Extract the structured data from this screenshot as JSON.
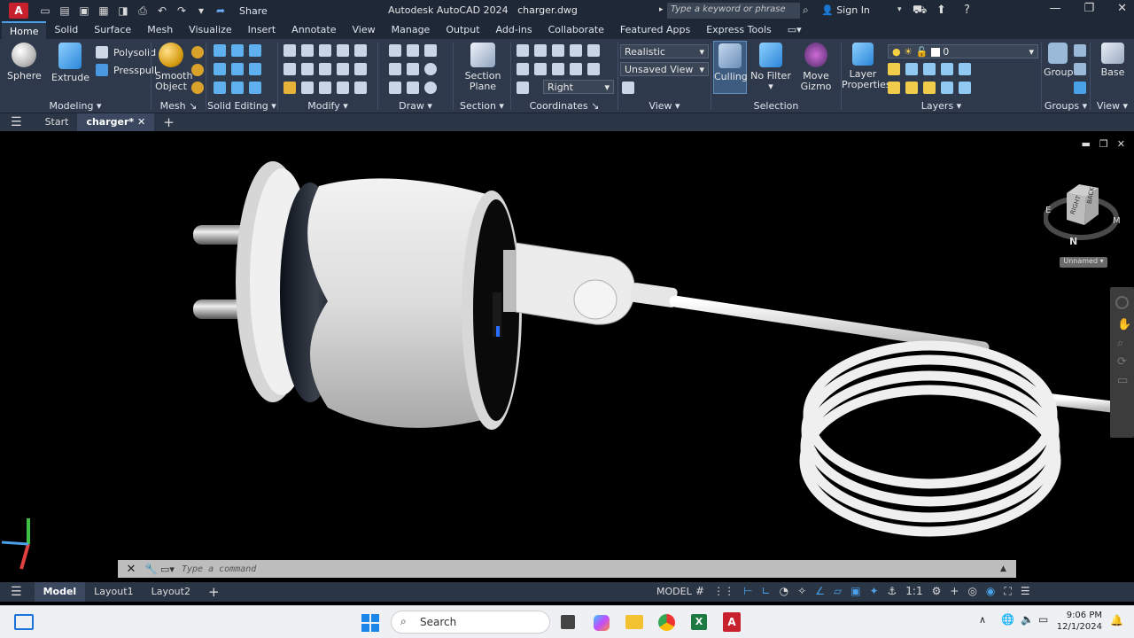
{
  "titlebar": {
    "app_letter": "A",
    "share_label": "Share",
    "title": "Autodesk AutoCAD 2024",
    "file": "charger.dwg",
    "search_placeholder": "Type a keyword or phrase",
    "signin_label": "Sign In"
  },
  "menu_tabs": [
    "Home",
    "Solid",
    "Surface",
    "Mesh",
    "Visualize",
    "Insert",
    "Annotate",
    "View",
    "Manage",
    "Output",
    "Add-ins",
    "Collaborate",
    "Featured Apps",
    "Express Tools"
  ],
  "ribbon": {
    "modeling": {
      "sphere": "Sphere",
      "extrude": "Extrude",
      "polysolid": "Polysolid",
      "presspull": "Presspull",
      "title": "Modeling"
    },
    "mesh": {
      "smooth_object_1": "Smooth",
      "smooth_object_2": "Object",
      "title": "Mesh"
    },
    "solid_editing": {
      "title": "Solid Editing"
    },
    "modify": {
      "title": "Modify"
    },
    "draw": {
      "title": "Draw"
    },
    "section": {
      "section_plane_1": "Section",
      "section_plane_2": "Plane",
      "title": "Section"
    },
    "coordinates": {
      "title": "Coordinates",
      "ucs_value": "Right"
    },
    "view": {
      "visual_style": "Realistic",
      "saved_view": "Unsaved View",
      "title": "View"
    },
    "selection": {
      "culling": "Culling",
      "no_filter": "No Filter",
      "move_gizmo_1": "Move",
      "move_gizmo_2": "Gizmo",
      "title": "Selection"
    },
    "layers": {
      "layer_properties_1": "Layer",
      "layer_properties_2": "Properties",
      "current_layer": "0",
      "title": "Layers"
    },
    "groups": {
      "group": "Group",
      "title": "Groups"
    },
    "view2": {
      "base": "Base",
      "title": "View"
    }
  },
  "doc_tabs": {
    "start": "Start",
    "active": "charger*"
  },
  "viewcube": {
    "right": "RIGHT",
    "back": "BACK",
    "west": "E",
    "north": "N",
    "east": "M",
    "unnamed": "Unnamed"
  },
  "command_line": {
    "placeholder": "Type a command"
  },
  "layout_tabs": [
    "Model",
    "Layout1",
    "Layout2"
  ],
  "status": {
    "model": "MODEL",
    "scale": "1:1"
  },
  "taskbar": {
    "search": "Search",
    "time": "9:06 PM",
    "date": "12/1/2024"
  },
  "colors": {
    "accent": "#4aa1e8",
    "autocad_red": "#c8202d",
    "ribbon_bg": "#2e3a4c",
    "titlebar_bg": "#1f2837"
  }
}
